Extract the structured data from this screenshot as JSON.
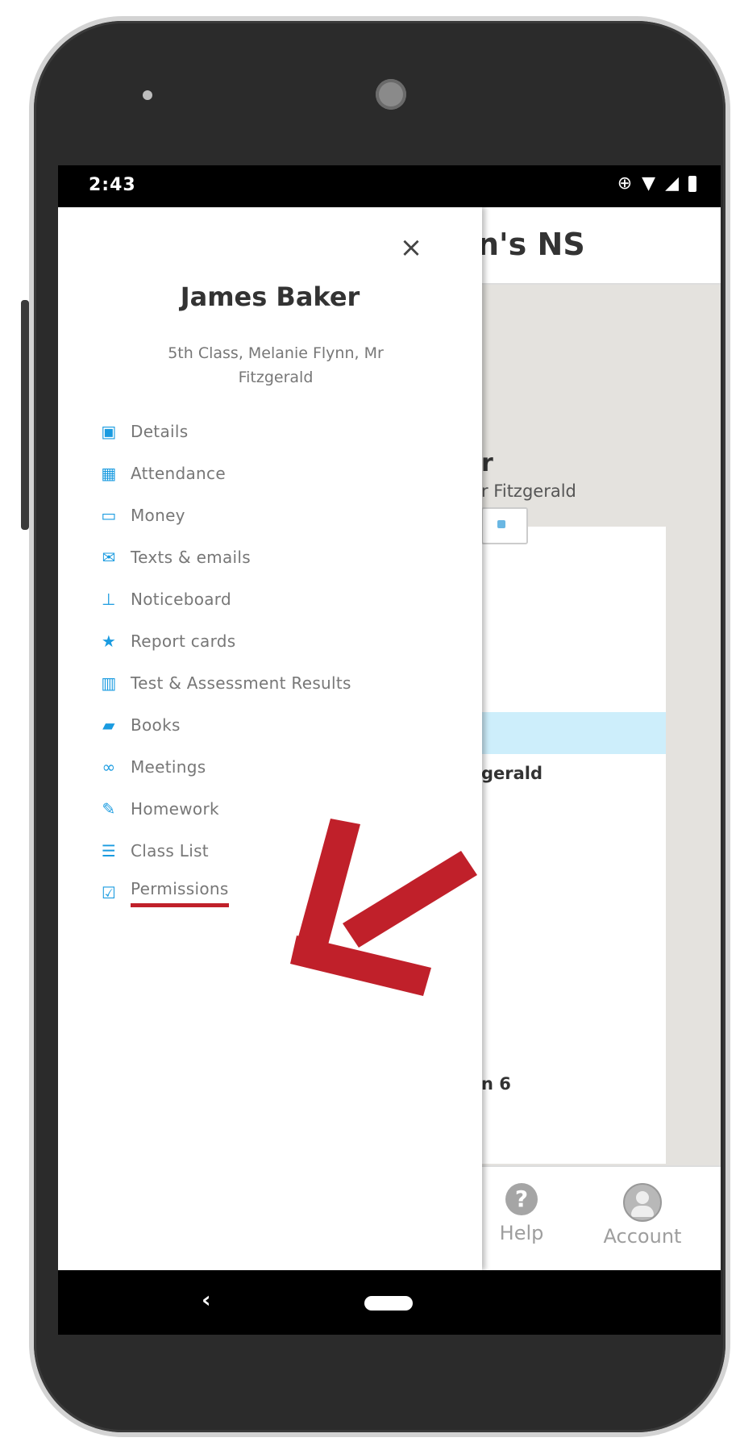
{
  "status_bar": {
    "time": "2:43"
  },
  "app": {
    "title_partial": "n's NS",
    "student_partial": "r",
    "class_partial": "r Fitzgerald",
    "teacher_partial": "gerald",
    "room_partial": "n 6"
  },
  "drawer": {
    "close_symbol": "×",
    "student_name": "James Baker",
    "student_details": "5th Class, Melanie Flynn, Mr Fitzgerald",
    "menu": [
      {
        "label": "Details",
        "icon": "id-card-icon",
        "glyph": "▣"
      },
      {
        "label": "Attendance",
        "icon": "calendar-icon",
        "glyph": "▦"
      },
      {
        "label": "Money",
        "icon": "money-icon",
        "glyph": "▭"
      },
      {
        "label": "Texts & emails",
        "icon": "envelope-icon",
        "glyph": "✉"
      },
      {
        "label": "Noticeboard",
        "icon": "pin-icon",
        "glyph": "⊥"
      },
      {
        "label": "Report cards",
        "icon": "star-icon",
        "glyph": "★"
      },
      {
        "label": "Test & Assessment Results",
        "icon": "bar-chart-icon",
        "glyph": "▥"
      },
      {
        "label": "Books",
        "icon": "book-icon",
        "glyph": "▰"
      },
      {
        "label": "Meetings",
        "icon": "handshake-icon",
        "glyph": "∞"
      },
      {
        "label": "Homework",
        "icon": "edit-icon",
        "glyph": "✎"
      },
      {
        "label": "Class List",
        "icon": "list-icon",
        "glyph": "☰"
      },
      {
        "label": "Permissions",
        "icon": "check-square-icon",
        "glyph": "☑"
      }
    ]
  },
  "bottom_nav": {
    "help_label": "Help",
    "help_glyph": "?",
    "account_label": "Account"
  },
  "android_nav": {
    "back_glyph": "‹"
  },
  "colors": {
    "accent": "#1a9be0",
    "annotation_red": "#c0202a"
  }
}
